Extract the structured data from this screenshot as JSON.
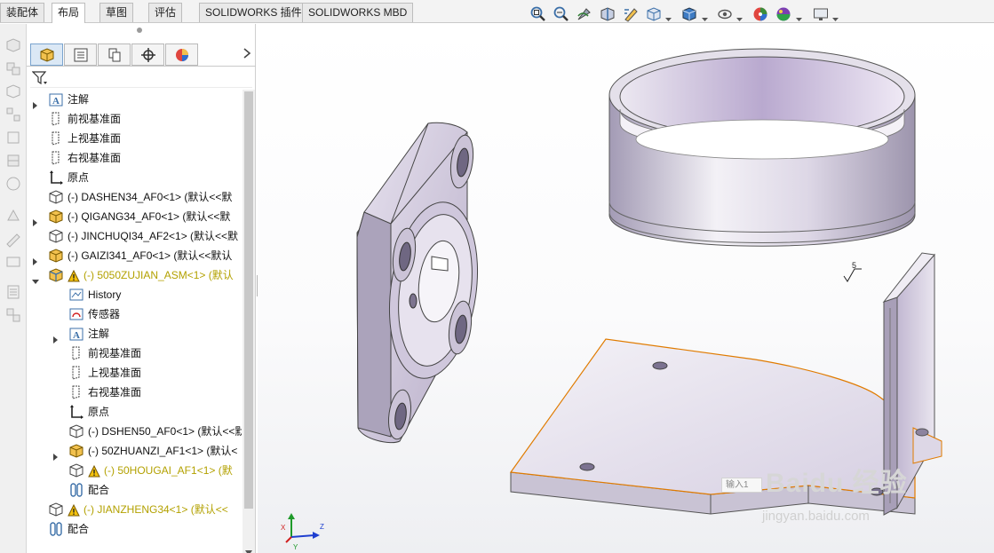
{
  "ribbon": {
    "tabs": [
      {
        "label": "装配体"
      },
      {
        "label": "布局"
      },
      {
        "label": "草图"
      },
      {
        "label": "评估"
      },
      {
        "label": "SOLIDWORKS 插件"
      },
      {
        "label": "SOLIDWORKS MBD"
      }
    ],
    "active_tab": "布局"
  },
  "view_toolbar": {
    "icons": [
      "zoom-to-fit-icon",
      "zoom-to-area-icon",
      "previous-view-icon",
      "section-view-icon",
      "dynamic-annotation-icon",
      "view-orientation-icon",
      "display-style-icon",
      "hide-show-icon",
      "edit-appearance-icon",
      "apply-scene-icon",
      "view-settings-icon"
    ]
  },
  "feature_manager": {
    "tabs": [
      "feature-manager-icon",
      "property-manager-icon",
      "configuration-manager-icon",
      "dimxpert-icon",
      "display-manager-icon"
    ],
    "tree": [
      {
        "label": "注解",
        "icon": "annotation-icon",
        "level": 0,
        "expandable": true,
        "warning": false
      },
      {
        "label": "前视基准面",
        "icon": "plane-icon",
        "level": 0,
        "expandable": false,
        "warning": false
      },
      {
        "label": "上视基准面",
        "icon": "plane-icon",
        "level": 0,
        "expandable": false,
        "warning": false
      },
      {
        "label": "右视基准面",
        "icon": "plane-icon",
        "level": 0,
        "expandable": false,
        "warning": false
      },
      {
        "label": "原点",
        "icon": "origin-icon",
        "level": 0,
        "expandable": false,
        "warning": false
      },
      {
        "label": "(-) DASHEN34_AF0<1> (默认<<默",
        "icon": "part-icon",
        "level": 0,
        "expandable": false,
        "warning": false
      },
      {
        "label": "(-) QIGANG34_AF0<1> (默认<<默",
        "icon": "part-yellow-icon",
        "level": 0,
        "expandable": true,
        "warning": false
      },
      {
        "label": "(-) JINCHUQI34_AF2<1> (默认<<默",
        "icon": "part-icon",
        "level": 0,
        "expandable": false,
        "warning": false
      },
      {
        "label": "(-) GAIZI341_AF0<1> (默认<<默认",
        "icon": "part-yellow-icon",
        "level": 0,
        "expandable": true,
        "warning": false
      },
      {
        "label": "(-) 5050ZUJIAN_ASM<1> (默认",
        "icon": "assembly-icon",
        "level": 0,
        "expandable": true,
        "expanded": true,
        "warning": true
      },
      {
        "label": "History",
        "icon": "history-icon",
        "level": 1,
        "expandable": false,
        "warning": false
      },
      {
        "label": "传感器",
        "icon": "sensor-icon",
        "level": 1,
        "expandable": false,
        "warning": false
      },
      {
        "label": "注解",
        "icon": "annotation-icon",
        "level": 1,
        "expandable": true,
        "warning": false
      },
      {
        "label": "前视基准面",
        "icon": "plane-icon",
        "level": 1,
        "expandable": false,
        "warning": false
      },
      {
        "label": "上视基准面",
        "icon": "plane-icon",
        "level": 1,
        "expandable": false,
        "warning": false
      },
      {
        "label": "右视基准面",
        "icon": "plane-icon",
        "level": 1,
        "expandable": false,
        "warning": false
      },
      {
        "label": "原点",
        "icon": "origin-icon",
        "level": 1,
        "expandable": false,
        "warning": false
      },
      {
        "label": "(-) DSHEN50_AF0<1> (默认<<默",
        "icon": "part-icon",
        "level": 1,
        "expandable": false,
        "warning": false
      },
      {
        "label": "(-) 50ZHUANZI_AF1<1> (默认<",
        "icon": "part-yellow-icon",
        "level": 1,
        "expandable": true,
        "warning": false
      },
      {
        "label": "(-) 50HOUGAI_AF1<1> (默",
        "icon": "part-icon",
        "level": 1,
        "expandable": false,
        "warning": true
      },
      {
        "label": "配合",
        "icon": "mates-icon",
        "level": 1,
        "expandable": false,
        "warning": false
      },
      {
        "label": "(-) JIANZHENG34<1> (默认<<",
        "icon": "part-icon",
        "level": 0,
        "expandable": false,
        "warning": true
      },
      {
        "label": "配合",
        "icon": "mates-icon",
        "level": 0,
        "expandable": false,
        "warning": false
      }
    ]
  },
  "viewport": {
    "surface_finish_value": "5",
    "triad_axes": [
      "X",
      "Y",
      "Z"
    ],
    "watermark": {
      "input_hint": "输入1",
      "brand": "Baidu 经验",
      "url": "jingyan.baidu.com"
    }
  },
  "colors": {
    "selection_edge": "#e07b00",
    "warning_text": "#b3a100",
    "part_face": "#d9d4e6",
    "part_shadow": "#9a93ad"
  }
}
